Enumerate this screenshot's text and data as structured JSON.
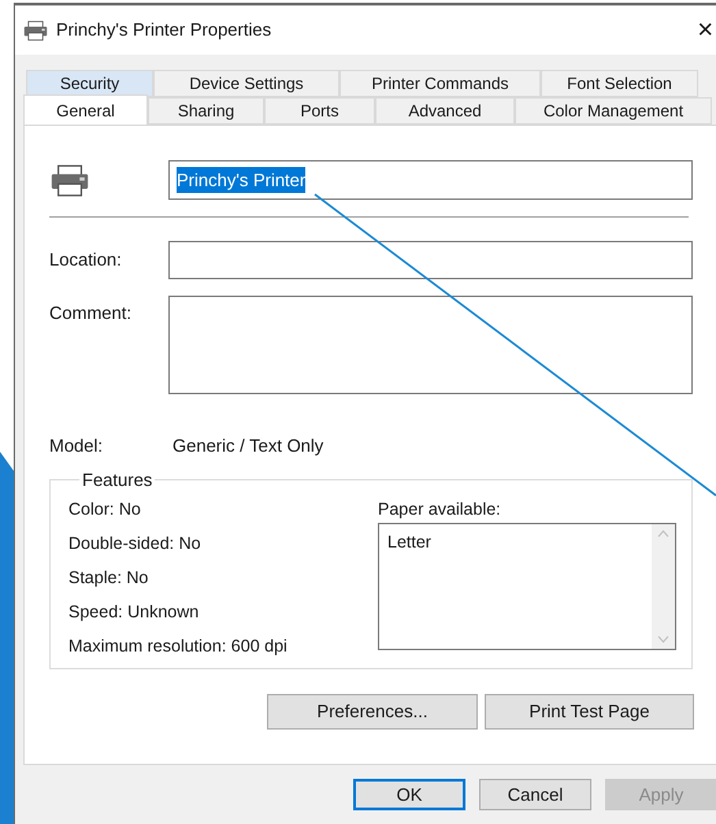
{
  "window": {
    "title": "Princhy's Printer Properties",
    "close": "×"
  },
  "tab_rows": [
    [
      {
        "label": "Security",
        "selected": false,
        "hovered": true
      },
      {
        "label": "Device Settings",
        "selected": false,
        "hovered": false
      },
      {
        "label": "Printer Commands",
        "selected": false,
        "hovered": false
      },
      {
        "label": "Font Selection",
        "selected": false,
        "hovered": false
      }
    ],
    [
      {
        "label": "General",
        "selected": true,
        "hovered": false
      },
      {
        "label": "Sharing",
        "selected": false,
        "hovered": false
      },
      {
        "label": "Ports",
        "selected": false,
        "hovered": false
      },
      {
        "label": "Advanced",
        "selected": false,
        "hovered": false
      },
      {
        "label": "Color Management",
        "selected": false,
        "hovered": false
      }
    ]
  ],
  "printer_name": {
    "value": "Princhy's Printer",
    "selected": true
  },
  "location": {
    "label": "Location:"
  },
  "comment": {
    "label": "Comment:"
  },
  "model": {
    "label": "Model:",
    "value": "Generic / Text Only"
  },
  "features": {
    "title": "Features",
    "items": [
      "Color: No",
      "Double-sided: No",
      "Staple: No",
      "Speed: Unknown",
      "Maximum resolution: 600 dpi"
    ],
    "paper_label": "Paper available:",
    "paper_items": [
      "Letter"
    ]
  },
  "panel_buttons": [
    {
      "label": "Preferences..."
    },
    {
      "label": "Print Test Page"
    }
  ],
  "footer_buttons": [
    {
      "label": "OK",
      "default": true,
      "disabled": false
    },
    {
      "label": "Cancel",
      "default": false,
      "disabled": false
    },
    {
      "label": "Apply",
      "default": false,
      "disabled": true
    }
  ]
}
